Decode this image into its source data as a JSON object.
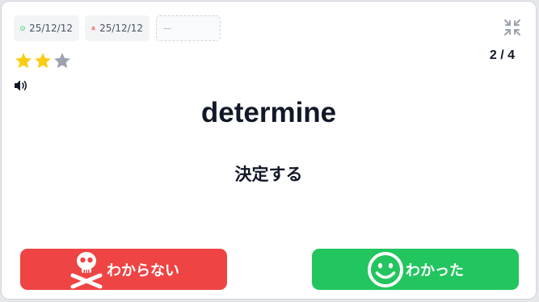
{
  "badges": {
    "known": {
      "icon": "smile-icon",
      "date": "25/12/12",
      "color": "#22c55e"
    },
    "unknown": {
      "icon": "skull-crossbones-icon",
      "date": "25/12/12",
      "color": "#ef4444"
    },
    "empty": {
      "text": "—"
    }
  },
  "stars": {
    "filled": 2,
    "total": 3,
    "filled_color": "#facc15",
    "empty_color": "#9ca3af"
  },
  "progress": "2 / 4",
  "card": {
    "word": "determine",
    "meaning": "決定する"
  },
  "buttons": {
    "unknown_label": "わからない",
    "unknown_icon": "skull-crossbones-icon",
    "unknown_color": "#ef4444",
    "known_label": "わかった",
    "known_icon": "smile-icon",
    "known_color": "#22c55e"
  },
  "icons": {
    "collapse": "collapse-icon",
    "speaker": "speaker-icon"
  }
}
